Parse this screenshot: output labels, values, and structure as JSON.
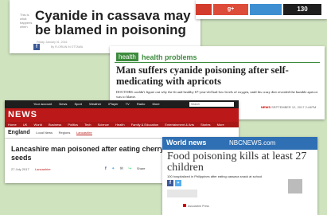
{
  "card1": {
    "side_text": "This is what happens when",
    "title": "Cyanide in cassava may be blamed in poisoning",
    "meta": "Friday, January 01, 2016",
    "byline": "By FLORIAN IN OTTAWA",
    "fb": "f"
  },
  "sharebar": {
    "gplus": "g+",
    "count": "130"
  },
  "card2": {
    "tag1": "health",
    "tag2": "health problems",
    "title": "Man suffers cyanide poisoning after self-medicating with apricots",
    "para": "DOCTORS couldn't figure out why the fit and healthy 67-year-old had low levels of oxygen, until his crazy diet revealed the humble apricot was to blame.",
    "foot_brand": "NEWS",
    "foot_date": "SEPTEMBER 12, 2017 2:44PM"
  },
  "card3": {
    "bbc": [
      "B",
      "B",
      "C"
    ],
    "nav": [
      "Your account",
      "News",
      "Sport",
      "Weather",
      "iPlayer",
      "TV",
      "Radio",
      "More"
    ],
    "search": "Search",
    "news_logo": "NEWS",
    "subnav": [
      "Home",
      "UK",
      "World",
      "Business",
      "Politics",
      "Tech",
      "Science",
      "Health",
      "Family & Education",
      "Entertainment & Arts",
      "Stories",
      "More"
    ],
    "crumb_main": "England",
    "crumb_items": [
      "Local News",
      "Regions"
    ],
    "crumb_active": "Lancashire",
    "title": "Lancashire man poisoned after eating cherry seeds",
    "date": "27 July 2017",
    "section": "Lancashire",
    "share_label": "Share"
  },
  "card4": {
    "worldnews": "World news",
    "nbc": "NBCNEWS.com",
    "title": "Food poisoning kills at least 27 children",
    "sub": "100 hospitalized in Philippines after eating cassava snack at school",
    "src": "Associated Press"
  },
  "colors": {
    "background": "#cfe3bf",
    "bbc_red": "#bb1919",
    "health_green": "#3d8b3d",
    "nbc_blue": "#2f6fb3"
  }
}
